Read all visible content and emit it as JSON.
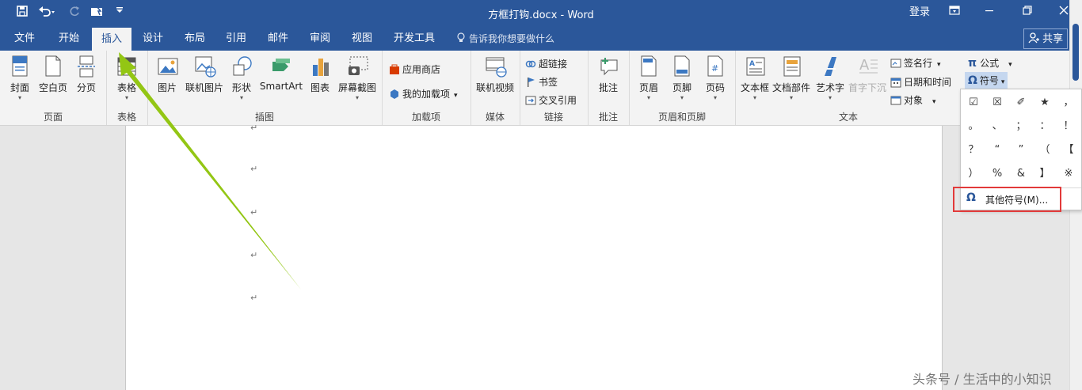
{
  "app": {
    "title": "方框打钩.docx - Word",
    "login": "登录",
    "share": "共享",
    "tell_me": "告诉我你想要做什么",
    "accent": "#2b579a",
    "highlight": "#e23a3a"
  },
  "quick_access": [
    "save-icon",
    "undo-icon",
    "redo-icon",
    "touch-mode-icon",
    "customize-icon"
  ],
  "tabs": [
    "文件",
    "开始",
    "插入",
    "设计",
    "布局",
    "引用",
    "邮件",
    "审阅",
    "视图",
    "开发工具"
  ],
  "active_tab": "插入",
  "groups": {
    "pages": {
      "name": "页面",
      "cover": "封面",
      "blank": "空白页",
      "break": "分页"
    },
    "tables": {
      "name": "表格",
      "table": "表格"
    },
    "illustrations": {
      "name": "插图",
      "picture": "图片",
      "online_picture": "联机图片",
      "shapes": "形状",
      "smartart": "SmartArt",
      "chart": "图表",
      "screenshot": "屏幕截图"
    },
    "addins": {
      "name": "加载项",
      "store": "应用商店",
      "my_addins": "我的加载项"
    },
    "media": {
      "name": "媒体",
      "online_video": "联机视频"
    },
    "links": {
      "name": "链接",
      "hyperlink": "超链接",
      "bookmark": "书签",
      "cross_ref": "交叉引用"
    },
    "comments": {
      "name": "批注",
      "comment": "批注"
    },
    "header_footer": {
      "name": "页眉和页脚",
      "header": "页眉",
      "footer": "页脚",
      "page_number": "页码"
    },
    "text": {
      "name": "文本",
      "textbox": "文本框",
      "quick_parts": "文档部件",
      "wordart": "艺术字",
      "dropcap": "首字下沉",
      "signature": "签名行",
      "datetime": "日期和时间",
      "object": "对象"
    },
    "symbols": {
      "equation": "公式",
      "symbol": "符号"
    }
  },
  "symbol_popup": {
    "symbols": [
      "☑",
      "☒",
      "✐",
      "★",
      "，",
      "。",
      "、",
      "；",
      "：",
      "！",
      "？",
      "“",
      "”",
      "（",
      "【",
      "）",
      "%",
      "&",
      "】",
      "※"
    ],
    "more_symbols": "其他符号(M)..."
  },
  "paragraph_mark": "↵",
  "watermark": "头条号 / 生活中的小知识"
}
